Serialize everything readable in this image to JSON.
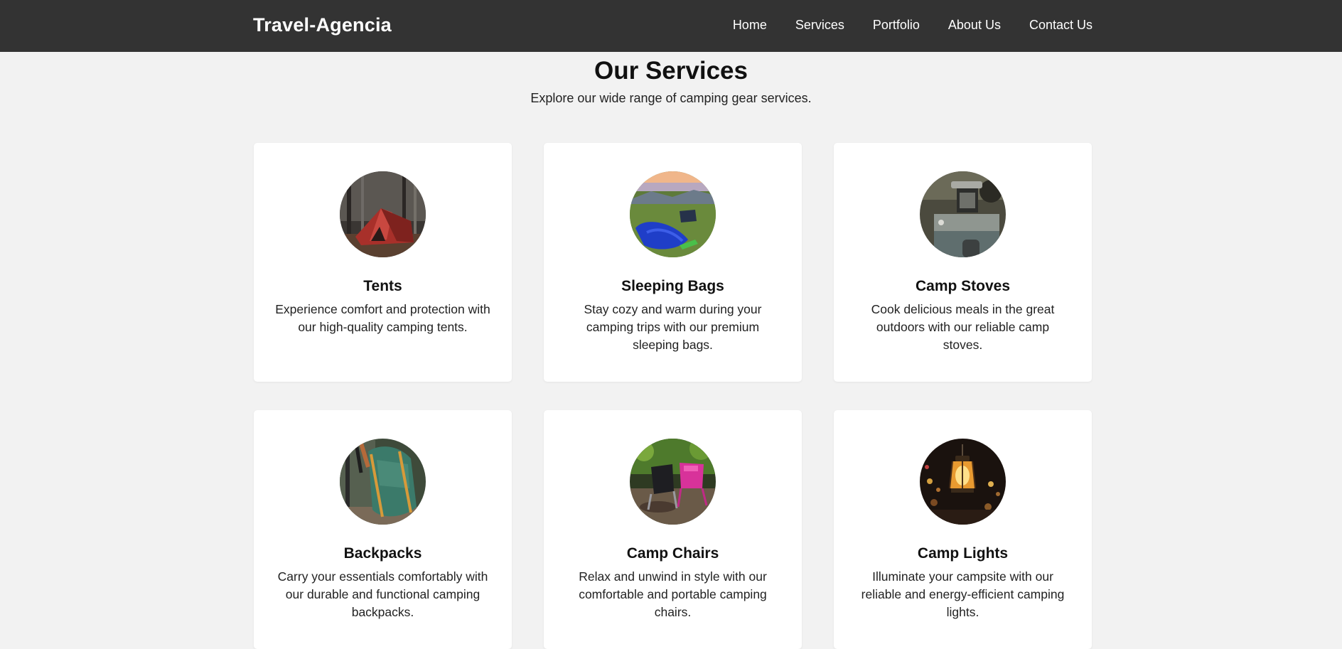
{
  "header": {
    "brand": "Travel-Agencia",
    "nav": [
      "Home",
      "Services",
      "Portfolio",
      "About Us",
      "Contact Us"
    ]
  },
  "section": {
    "title": "Our Services",
    "subtitle": "Explore our wide range of camping gear services."
  },
  "services": [
    {
      "title": "Tents",
      "text": "Experience comfort and protection with our high-quality camping tents.",
      "icon": "tent-photo"
    },
    {
      "title": "Sleeping Bags",
      "text": "Stay cozy and warm during your camping trips with our premium sleeping bags.",
      "icon": "sleeping-bag-photo"
    },
    {
      "title": "Camp Stoves",
      "text": "Cook delicious meals in the great outdoors with our reliable camp stoves.",
      "icon": "camp-stove-photo"
    },
    {
      "title": "Backpacks",
      "text": "Carry your essentials comfortably with our durable and functional camping backpacks.",
      "icon": "backpack-photo"
    },
    {
      "title": "Camp Chairs",
      "text": "Relax and unwind in style with our comfortable and portable camping chairs.",
      "icon": "camp-chair-photo"
    },
    {
      "title": "Camp Lights",
      "text": "Illuminate your campsite with our reliable and energy-efficient camping lights.",
      "icon": "camp-light-photo"
    }
  ],
  "colors": {
    "navbar": "#333333",
    "background": "#f2f2f2",
    "card": "#ffffff"
  }
}
